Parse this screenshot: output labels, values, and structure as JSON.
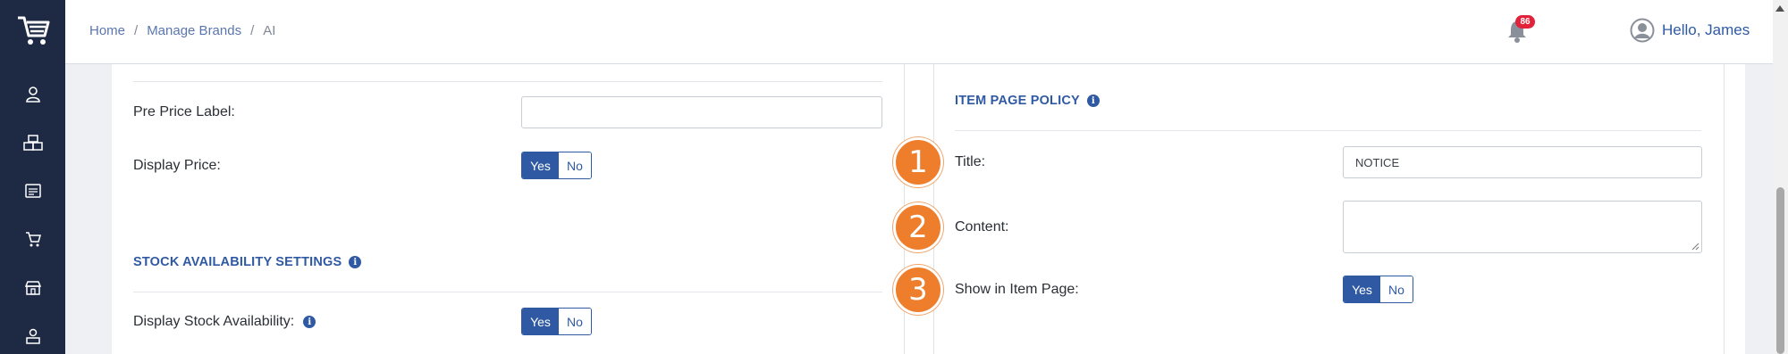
{
  "breadcrumb": {
    "home": "Home",
    "sep1": "/",
    "manage": "Manage Brands",
    "sep2": "/",
    "current": "AI"
  },
  "header": {
    "notification_count": "86",
    "greeting": "Hello, James"
  },
  "left_panel": {
    "pre_price_label": "Pre Price Label:",
    "pre_price_value": "",
    "display_price_label": "Display Price:",
    "display_price_yes": "Yes",
    "display_price_no": "No",
    "stock_section_title": "STOCK AVAILABILITY SETTINGS",
    "display_stock_label": "Display Stock Availability:",
    "display_stock_yes": "Yes",
    "display_stock_no": "No"
  },
  "right_panel": {
    "section_title": "ITEM PAGE POLICY",
    "title_label": "Title:",
    "title_value": "NOTICE",
    "content_label": "Content:",
    "content_value": "",
    "show_label": "Show in Item Page:",
    "show_yes": "Yes",
    "show_no": "No"
  },
  "steps": [
    "1",
    "2",
    "3"
  ],
  "colors": {
    "sidebar": "#1e2a44",
    "accent": "#2f5aa3",
    "step": "#ee7e2b",
    "badge": "#e0223b"
  }
}
